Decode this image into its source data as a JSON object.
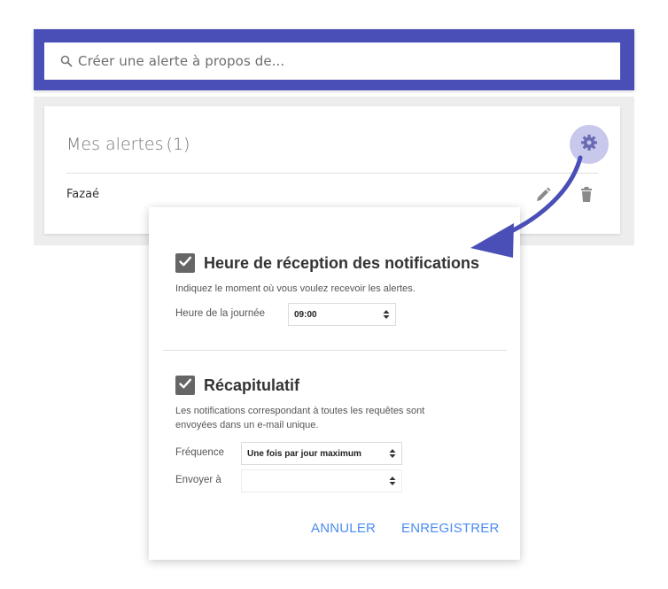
{
  "search": {
    "placeholder": "Créer une alerte à propos de..."
  },
  "alerts": {
    "title": "Mes alertes",
    "count": "(1)",
    "items": [
      {
        "name": "Fazaé"
      }
    ]
  },
  "popup": {
    "delivery": {
      "checked": true,
      "title": "Heure de réception des notifications",
      "description": "Indiquez le moment où vous voulez recevoir les alertes.",
      "time_label": "Heure de la journée",
      "time_value": "09:00"
    },
    "digest": {
      "checked": true,
      "title": "Récapitulatif",
      "description_line1": "Les notifications correspondant à toutes les requêtes sont",
      "description_line2": "envoyées dans un e-mail unique.",
      "frequency_label": "Fréquence",
      "frequency_value": "Une fois par jour maximum",
      "send_to_label": "Envoyer à",
      "send_to_value": ""
    },
    "cancel_label": "ANNULER",
    "save_label": "ENREGISTRER"
  },
  "colors": {
    "banner": "#4a4fb7",
    "accent_button_text": "#4a8cf0",
    "gear_circle": "#c7c8ec",
    "arrow": "#4a4fb7"
  },
  "icons": {
    "search": "search-icon",
    "settings": "gear-icon",
    "edit": "pencil-icon",
    "delete": "trash-icon",
    "checkbox": "checkbox-checked-icon",
    "select": "select-arrows-icon",
    "pointer": "curved-arrow-icon"
  }
}
